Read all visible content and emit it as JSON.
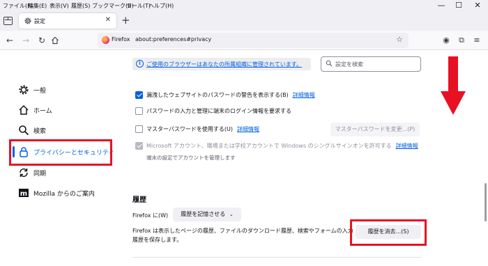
{
  "menubar": {
    "items": [
      "ファイル(F)",
      "編集(E)",
      "表示(V)",
      "履歴(S)",
      "ブックマーク(B)",
      "ツール(T)",
      "ヘルプ(H)"
    ]
  },
  "tab": {
    "title": "設定",
    "icon": "gear-icon"
  },
  "navbar": {
    "site_label": "Firefox",
    "url": "about:preferences#privacy"
  },
  "sidebar": {
    "items": [
      {
        "label": "一般",
        "icon": "gear-icon"
      },
      {
        "label": "ホーム",
        "icon": "home-icon"
      },
      {
        "label": "検索",
        "icon": "search-icon"
      },
      {
        "label": "プライバシーとセキュリティ",
        "icon": "lock-icon"
      },
      {
        "label": "同期",
        "icon": "sync-icon"
      },
      {
        "label": "Mozilla からのご案内",
        "icon": "mozilla-icon"
      }
    ]
  },
  "main": {
    "policy_notice": "ご使用のブラウザーはあなたの所属組織に管理されています。",
    "search_placeholder": "設定を検索",
    "breach_alert": {
      "label": "漏洩したウェブサイトのパスワードの警告を表示する(B)",
      "link": "詳細情報",
      "checked": true
    },
    "os_auth": {
      "label": "パスワードの入力と管理に端末のログイン情報を要求する",
      "checked": false
    },
    "master_password": {
      "label": "マスターパスワードを使用する(U)",
      "link": "詳細情報",
      "checked": false,
      "button": "マスターパスワードを変更...(P)"
    },
    "windows_sso": {
      "label": "Microsoft アカウント、職場または学校アカウントで Windows のシングルサインオンを許可する",
      "link": "詳細情報",
      "checked": true,
      "note": "端末の設定でアカウントを管理します"
    },
    "history": {
      "title": "履歴",
      "label": "Firefox に(W)",
      "dropdown": "履歴を記憶させる",
      "description": "Firefox は表示したページの履歴、ファイルのダウンロード履歴、検索やフォームの入力履歴を保存します。",
      "clear_button": "履歴を消去...(S)"
    }
  },
  "colors": {
    "accent": "#0061e0",
    "annotation": "#e81123"
  }
}
